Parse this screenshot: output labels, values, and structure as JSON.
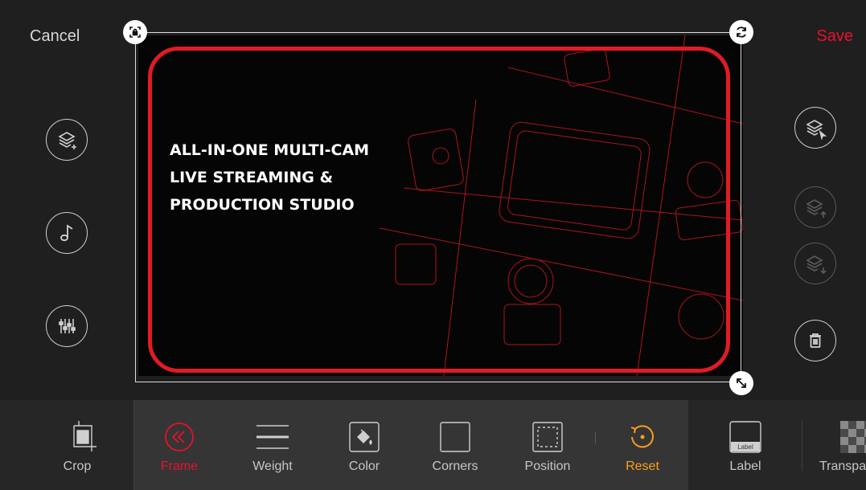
{
  "header": {
    "cancel_label": "Cancel",
    "save_label": "Save"
  },
  "canvas": {
    "headline": [
      "ALL-IN-ONE MULTI-CAM",
      "LIVE STREAMING &",
      "PRODUCTION STUDIO"
    ]
  },
  "left_tools": [
    {
      "icon": "add-layer-icon"
    },
    {
      "icon": "music-note-icon"
    },
    {
      "icon": "equalizer-icon"
    }
  ],
  "right_tools": [
    {
      "icon": "select-layer-icon",
      "enabled": true
    },
    {
      "icon": "layer-up-icon",
      "enabled": false
    },
    {
      "icon": "layer-down-icon",
      "enabled": false
    },
    {
      "icon": "trash-icon",
      "enabled": true
    }
  ],
  "toolbar": {
    "crop": "Crop",
    "frame": "Frame",
    "weight": "Weight",
    "color": "Color",
    "corners": "Corners",
    "position": "Position",
    "reset": "Reset",
    "label": "Label",
    "label_thumb": "Label",
    "transparency": "Transpa"
  },
  "colors": {
    "accent_red": "#e8112d",
    "reset_orange": "#ff9e1b",
    "frame_red": "#e01b24"
  }
}
